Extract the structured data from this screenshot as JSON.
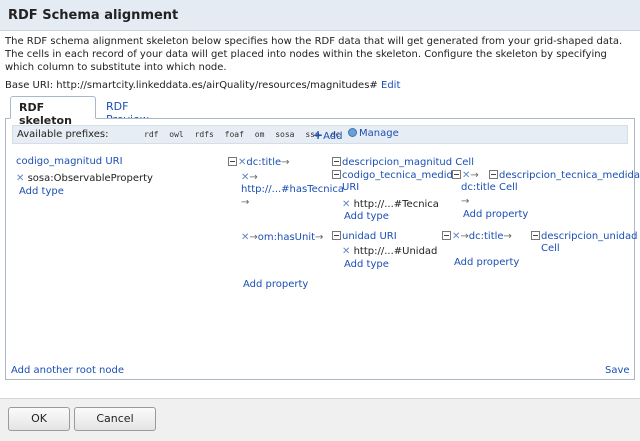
{
  "dialog": {
    "title": "RDF Schema alignment"
  },
  "description": "The RDF schema alignment skeleton below specifies how the RDF data that will get generated from your grid-shaped data. The cells in each record of your data will get placed into nodes within the skeleton. Configure the skeleton by specifying which column to substitute into which node.",
  "base_uri": {
    "label": "Base URI: http://smartcity.linkeddata.es/airQuality/resources/magnitudes#",
    "edit": "Edit"
  },
  "tabs": [
    {
      "label": "RDF skeleton"
    },
    {
      "label": "RDF Preview"
    }
  ],
  "prefixes": {
    "label": "Available prefixes:",
    "items": [
      "rdf",
      "owl",
      "rdfs",
      "foaf",
      "om",
      "sosa",
      "ssn",
      "dc"
    ],
    "add": "Add",
    "manage": "Manage"
  },
  "skeleton": {
    "root": {
      "name": "codigo_magnitud URI",
      "type": "sosa:ObservableProperty",
      "add_type": "Add type"
    },
    "p1": {
      "label": "dc:title"
    },
    "p2": {
      "label_line1": "",
      "label_line2": "http://...#hasTecnica"
    },
    "p3": {
      "label": "om:hasUnit"
    },
    "add_property": "Add property",
    "n1": {
      "label": "descripcion_magnitud Cell"
    },
    "n2": {
      "label_line1": "codigo_tecnica_medida",
      "label_line2": "URI",
      "type": "http://...#Tecnica",
      "add_type": "Add type"
    },
    "n2_p": {
      "label": "dc:title",
      "add_property": "Add property"
    },
    "n2_c": {
      "label_line1": "descripcion_tecnica_medida",
      "label_line2": "Cell"
    },
    "n3": {
      "label": "unidad URI",
      "type": "http://...#Unidad",
      "add_type": "Add type"
    },
    "n3_p": {
      "label": "dc:title",
      "add_property": "Add property"
    },
    "n3_c": {
      "label_line1": "descripcion_unidad",
      "label_line2": "Cell"
    }
  },
  "add_root": "Add another root node",
  "save": "Save",
  "buttons": {
    "ok": "OK",
    "cancel": "Cancel"
  }
}
